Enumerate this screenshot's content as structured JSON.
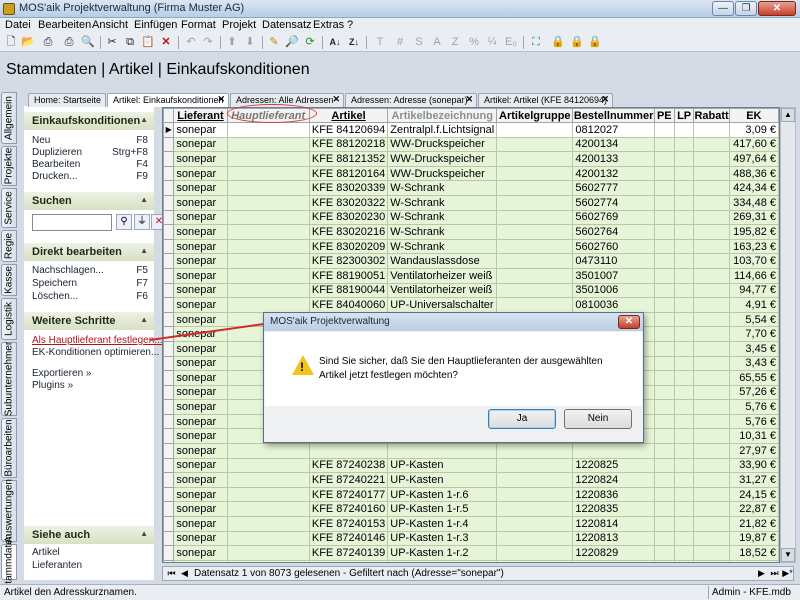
{
  "window": {
    "title": "MOS'aik Projektverwaltung (Firma Muster AG)",
    "buttons": [
      "—",
      "❐",
      "✕"
    ]
  },
  "menu": [
    "Datei",
    "Bearbeiten",
    "Ansicht",
    "Einfügen",
    "Format",
    "Projekt",
    "Datensatz",
    "Extras",
    "?"
  ],
  "toolbar": {
    "text_buttons": [
      "T",
      "#",
      "S",
      "A",
      "Z",
      "%",
      "¼",
      "E₀"
    ]
  },
  "page_title": "Stammdaten | Artikel | Einkaufskonditionen",
  "vertical_tabs": [
    "Allgemein",
    "Projekte",
    "Service",
    "Regie",
    "Kasse",
    "Logistik",
    "Subunternehmer",
    "Büroarbeiten",
    "Auswertungen",
    "Stammdaten"
  ],
  "doc_tabs": [
    "Home: Startseite",
    "Artikel: Einkaufskonditionen",
    "Adressen: Alle Adressen",
    "Adressen: Adresse (sonepar)",
    "Artikel: Artikel (KFE 84120694)"
  ],
  "side": {
    "einkauf": {
      "title": "Einkaufskonditionen",
      "items": [
        {
          "label": "Neu",
          "key": "F8"
        },
        {
          "label": "Duplizieren",
          "key": "Strg+F8"
        },
        {
          "label": "Bearbeiten",
          "key": "F4"
        },
        {
          "label": "Drucken...",
          "key": "F9"
        }
      ]
    },
    "suchen": {
      "title": "Suchen",
      "value": ""
    },
    "direkt": {
      "title": "Direkt bearbeiten",
      "items": [
        {
          "label": "Nachschlagen...",
          "key": "F5"
        },
        {
          "label": "Speichern",
          "key": "F7"
        },
        {
          "label": "Löschen...",
          "key": "F6"
        }
      ]
    },
    "weitere": {
      "title": "Weitere Schritte",
      "items": [
        "Als Hauptlieferant festlegen...",
        "EK-Konditionen optimieren...",
        "Exportieren »",
        "Plugins »"
      ]
    },
    "siehe": {
      "title": "Siehe auch",
      "items": [
        "Artikel",
        "Lieferanten"
      ]
    }
  },
  "grid": {
    "columns": [
      "Lieferant",
      "Hauptlieferant",
      "Artikel",
      "Artikelbezeichnung",
      "Artikelgruppe",
      "Bestellnummer",
      "PE",
      "LP",
      "Rabatt",
      "EK"
    ],
    "rows": [
      [
        "sonepar",
        "",
        "KFE 84120694",
        "Zentralpl.f.Lichtsignal",
        "",
        "0812027",
        "",
        "",
        "",
        "3,09 €"
      ],
      [
        "sonepar",
        "",
        "KFE 88120218",
        "WW-Druckspeicher",
        "",
        "4200134",
        "",
        "",
        "",
        "417,60 €"
      ],
      [
        "sonepar",
        "",
        "KFE 88121352",
        "WW-Druckspeicher",
        "",
        "4200133",
        "",
        "",
        "",
        "497,64 €"
      ],
      [
        "sonepar",
        "",
        "KFE 88120164",
        "WW-Druckspeicher",
        "",
        "4200132",
        "",
        "",
        "",
        "488,36 €"
      ],
      [
        "sonepar",
        "",
        "KFE 83020339",
        "W-Schrank",
        "",
        "5602777",
        "",
        "",
        "",
        "424,34 €"
      ],
      [
        "sonepar",
        "",
        "KFE 83020322",
        "W-Schrank",
        "",
        "5602774",
        "",
        "",
        "",
        "334,48 €"
      ],
      [
        "sonepar",
        "",
        "KFE 83020230",
        "W-Schrank",
        "",
        "5602769",
        "",
        "",
        "",
        "269,31 €"
      ],
      [
        "sonepar",
        "",
        "KFE 83020216",
        "W-Schrank",
        "",
        "5602764",
        "",
        "",
        "",
        "195,82 €"
      ],
      [
        "sonepar",
        "",
        "KFE 83020209",
        "W-Schrank",
        "",
        "5602760",
        "",
        "",
        "",
        "163,23 €"
      ],
      [
        "sonepar",
        "",
        "KFE 82300302",
        "Wandauslassdose",
        "",
        "0473110",
        "",
        "",
        "",
        "103,70 €"
      ],
      [
        "sonepar",
        "",
        "KFE 88190051",
        "Ventilatorheizer weiß",
        "",
        "3501007",
        "",
        "",
        "",
        "114,66 €"
      ],
      [
        "sonepar",
        "",
        "KFE 88190044",
        "Ventilatorheizer weiß",
        "",
        "3501006",
        "",
        "",
        "",
        "94,77 €"
      ],
      [
        "sonepar",
        "",
        "KFE 84040060",
        "UP-Universalschalter",
        "",
        "0810036",
        "",
        "",
        "",
        "4,91 €"
      ],
      [
        "sonepar",
        "",
        "KFE 84040138",
        "UP-Taster Einsatz",
        "",
        "0810550",
        "",
        "",
        "",
        "5,54 €"
      ],
      [
        "sonepar",
        "",
        "",
        "",
        "",
        "",
        "",
        "",
        "",
        "7,70 €"
      ],
      [
        "sonepar",
        "",
        "",
        "",
        "",
        "",
        "",
        "",
        "",
        "3,45 €"
      ],
      [
        "sonepar",
        "",
        "",
        "",
        "",
        "",
        "",
        "",
        "",
        "3,43 €"
      ],
      [
        "sonepar",
        "",
        "",
        "",
        "",
        "",
        "",
        "",
        "",
        "65,55 €"
      ],
      [
        "sonepar",
        "",
        "",
        "",
        "",
        "",
        "",
        "",
        "",
        "57,26 €"
      ],
      [
        "sonepar",
        "",
        "",
        "",
        "",
        "",
        "",
        "",
        "",
        "5,76 €"
      ],
      [
        "sonepar",
        "",
        "",
        "",
        "",
        "",
        "",
        "",
        "",
        "5,76 €"
      ],
      [
        "sonepar",
        "",
        "",
        "",
        "",
        "",
        "",
        "",
        "",
        "10,31 €"
      ],
      [
        "sonepar",
        "",
        "",
        "",
        "",
        "",
        "",
        "",
        "",
        "27,97 €"
      ],
      [
        "sonepar",
        "",
        "KFE 87240238",
        "UP-Kasten",
        "",
        "1220825",
        "",
        "",
        "",
        "33,90 €"
      ],
      [
        "sonepar",
        "",
        "KFE 87240221",
        "UP-Kasten",
        "",
        "1220824",
        "",
        "",
        "",
        "31,27 €"
      ],
      [
        "sonepar",
        "",
        "KFE 87240177",
        "UP-Kasten 1-r.6",
        "",
        "1220836",
        "",
        "",
        "",
        "24,15 €"
      ],
      [
        "sonepar",
        "",
        "KFE 87240160",
        "UP-Kasten 1-r.5",
        "",
        "1220835",
        "",
        "",
        "",
        "22,87 €"
      ],
      [
        "sonepar",
        "",
        "KFE 87240153",
        "UP-Kasten 1-r.4",
        "",
        "1220814",
        "",
        "",
        "",
        "21,82 €"
      ],
      [
        "sonepar",
        "",
        "KFE 87240146",
        "UP-Kasten 1-r.3",
        "",
        "1220813",
        "",
        "",
        "",
        "19,87 €"
      ],
      [
        "sonepar",
        "",
        "KFE 87240139",
        "UP-Kasten 1-r.2",
        "",
        "1220829",
        "",
        "",
        "",
        "18,52 €"
      ],
      [
        "sonepar",
        "",
        "KFE 87240122",
        "UP-Kasten 1-r.1",
        "",
        "1220828",
        "",
        "",
        "",
        "16,57 €"
      ]
    ]
  },
  "navigator": {
    "text": "Datensatz 1 von 8073 gelesenen - Gefiltert nach (Adresse=\"sonepar\")"
  },
  "status": {
    "left": "Artikel den Adresskurznamen.",
    "right": "Admin - KFE.mdb"
  },
  "dialog": {
    "title": "MOS'aik Projektverwaltung",
    "close": "✕",
    "message": "Sind Sie sicher, daß Sie den Hauptlieferanten der ausgewählten Artikel jetzt festlegen möchten?",
    "yes": "Ja",
    "no": "Nein"
  }
}
